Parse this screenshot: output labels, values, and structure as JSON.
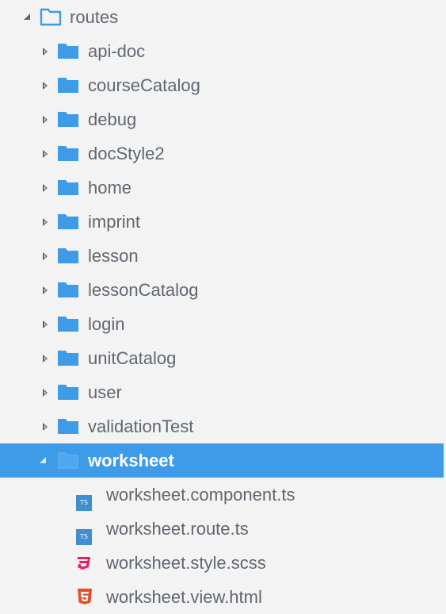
{
  "explorer": {
    "root": {
      "label": "routes",
      "icon": "folder-open-outline-icon",
      "color": "#3e9be8"
    },
    "folders": [
      {
        "label": "api-doc",
        "icon": "folder-icon"
      },
      {
        "label": "courseCatalog",
        "icon": "folder-icon"
      },
      {
        "label": "debug",
        "icon": "folder-icon"
      },
      {
        "label": "docStyle2",
        "icon": "folder-icon"
      },
      {
        "label": "home",
        "icon": "folder-icon"
      },
      {
        "label": "imprint",
        "icon": "folder-icon"
      },
      {
        "label": "lesson",
        "icon": "folder-icon"
      },
      {
        "label": "lessonCatalog",
        "icon": "folder-icon"
      },
      {
        "label": "login",
        "icon": "folder-icon"
      },
      {
        "label": "unitCatalog",
        "icon": "folder-icon"
      },
      {
        "label": "user",
        "icon": "folder-icon"
      },
      {
        "label": "validationTest",
        "icon": "folder-icon"
      }
    ],
    "selected_folder": {
      "label": "worksheet",
      "icon": "folder-open-icon",
      "highlight_color": "#3e9be8"
    },
    "files": [
      {
        "label": "worksheet.component.ts",
        "icon": "typescript-icon",
        "badge": "TS",
        "color": "#3e8ed0"
      },
      {
        "label": "worksheet.route.ts",
        "icon": "typescript-icon",
        "badge": "TS",
        "color": "#3e8ed0"
      },
      {
        "label": "worksheet.style.scss",
        "icon": "css3-icon",
        "color": "#e91e63"
      },
      {
        "label": "worksheet.view.html",
        "icon": "html5-icon",
        "color": "#e44d26"
      }
    ]
  }
}
